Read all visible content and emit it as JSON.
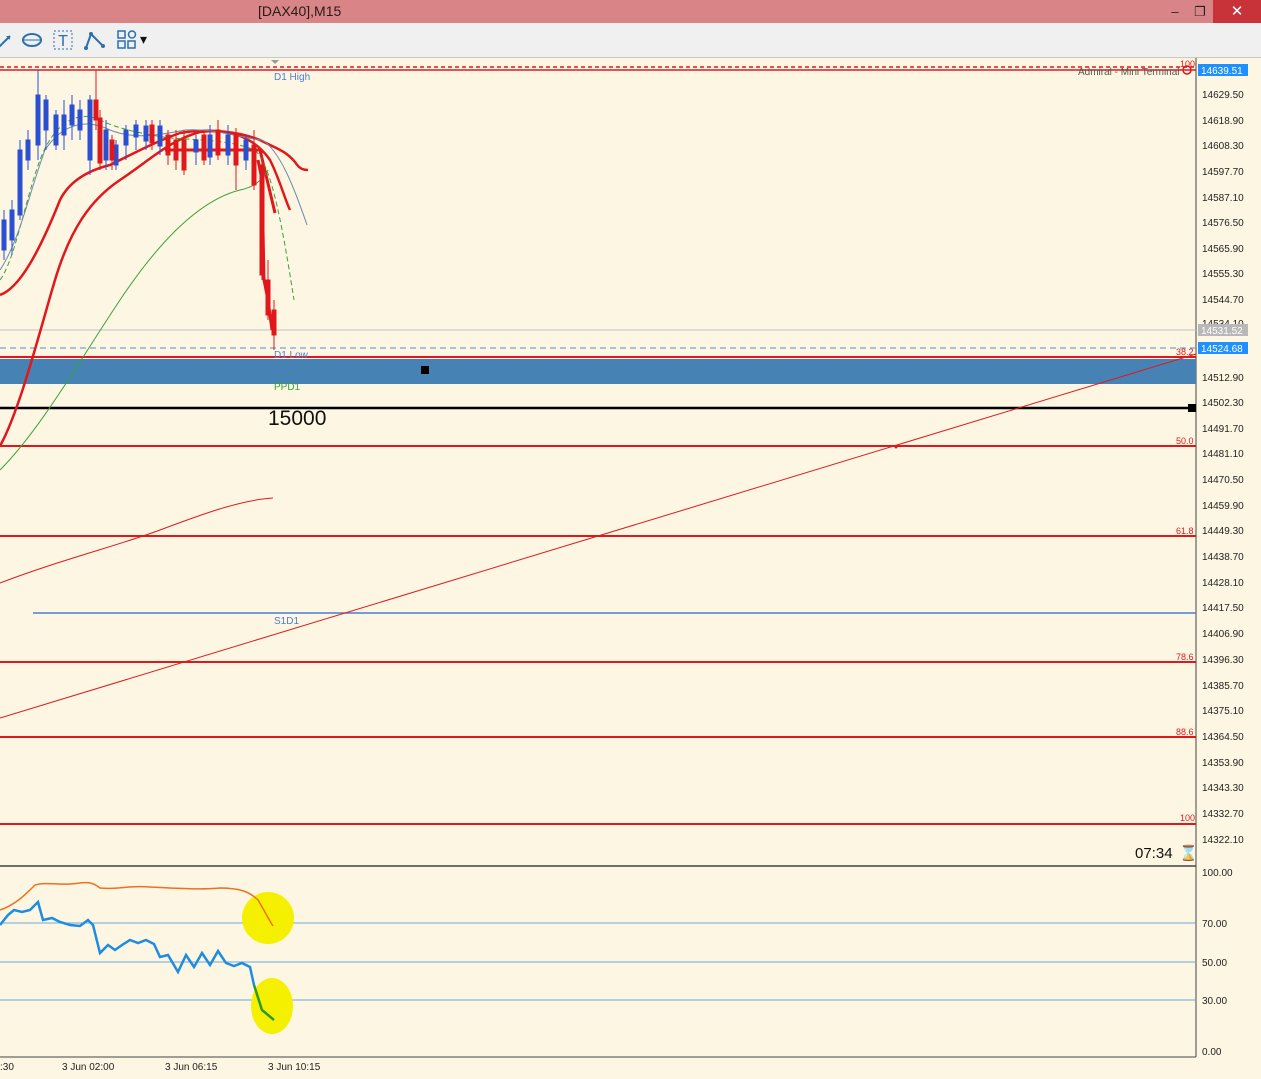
{
  "window": {
    "title": "[DAX40],M15",
    "controls": {
      "minimize": "–",
      "restore": "❐",
      "close": "✕"
    }
  },
  "toolbar": {
    "tools": [
      "trendline-icon",
      "shapes-icon",
      "text-icon",
      "fibo-icon",
      "objects-icon"
    ],
    "dropdown": "▾"
  },
  "chart": {
    "indicator_label": "Admiral - Mini Terminal",
    "countdown": "07:34",
    "colors": {
      "bg": "#fdf6e3",
      "fib": "#e0181c",
      "zone": "#4682b4",
      "s1": "#4a7fd4"
    },
    "price_axis": [
      "14639.51",
      "14629.50",
      "14618.90",
      "14608.30",
      "14597.70",
      "14587.10",
      "14576.50",
      "14565.90",
      "14555.30",
      "14544.70",
      "14534.10",
      "14531.52",
      "14524.68",
      "14512.90",
      "14502.30",
      "14491.70",
      "14481.10",
      "14470.50",
      "14459.90",
      "14449.30",
      "14438.70",
      "14428.10",
      "14417.50",
      "14406.90",
      "14396.30",
      "14385.70",
      "14375.10",
      "14364.50",
      "14353.90",
      "14343.30",
      "14332.70",
      "14322.10"
    ],
    "fib_levels": [
      "100",
      "38.2",
      "50.0",
      "61.8",
      "78.6",
      "88.6",
      "100"
    ],
    "labels": {
      "d1_high": "D1 High",
      "d1_low": "D1 Low",
      "ppd1": "PPD1",
      "s1d1": "S1D1",
      "round_number": "15000"
    },
    "oscillator_axis": [
      "100.00",
      "70.00",
      "50.00",
      "30.00",
      "0.00"
    ],
    "time_axis": [
      ":30",
      "3 Jun 02:00",
      "3 Jun 06:15",
      "3 Jun 10:15"
    ]
  }
}
